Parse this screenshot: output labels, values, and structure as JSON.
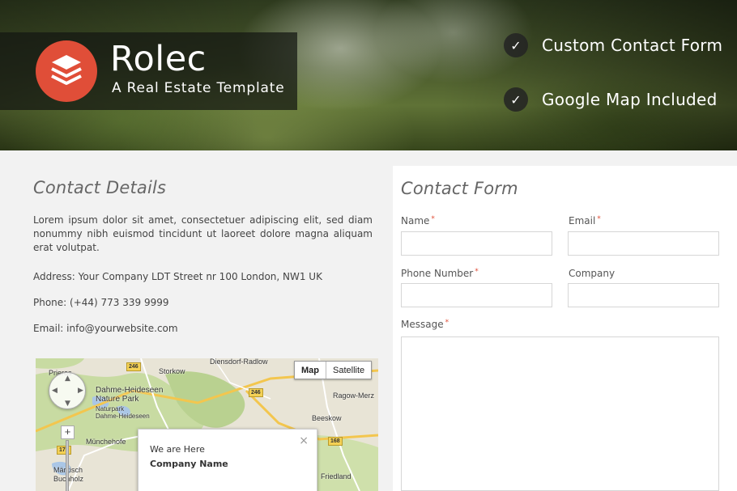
{
  "brand": {
    "name": "Rolec",
    "tagline": "A Real Estate Template",
    "logo_color": "#e04e38"
  },
  "features": [
    {
      "label": "Custom Contact Form",
      "icon": "check-icon"
    },
    {
      "label": "Google Map Included",
      "icon": "check-icon"
    }
  ],
  "details": {
    "title": "Contact Details",
    "intro": "Lorem ipsum dolor sit amet, consectetuer adipiscing elit, sed diam nonummy nibh euismod tincidunt ut laoreet dolore magna aliquam erat volutpat.",
    "address": "Address: Your Company LDT Street nr 100 London, NW1 UK",
    "phone": "Phone: (+44) 773 339 9999",
    "email": "Email: info@yourwebsite.com"
  },
  "map": {
    "type_map": "Map",
    "type_satellite": "Satellite",
    "zoom_in": "+",
    "labels": {
      "diensdorf": "Diensdorf-Radlow",
      "storkow": "Storkow",
      "prieros": "Prieros",
      "dahme": "Dahme-Heideseen",
      "nature_park": "Nature Park",
      "naturpark": "Naturpark",
      "dahme_de": "Dahme-Heideseen",
      "ragow": "Ragow-Merz",
      "beeskow": "Beeskow",
      "munchehofe": "Münchehofe",
      "markisch": "Märkisch",
      "buchholz": "Buchholz",
      "friedland": "Friedland"
    },
    "roads": {
      "r1": "246",
      "r2": "246",
      "r3": "179",
      "r4": "168"
    },
    "info": {
      "line1": "We are Here",
      "line2": "Company Name",
      "close": "×"
    }
  },
  "form": {
    "title": "Contact Form",
    "name_label": "Name",
    "email_label": "Email",
    "phone_label": "Phone Number",
    "company_label": "Company",
    "message_label": "Message",
    "required_mark": "*",
    "name_value": "",
    "email_value": "",
    "phone_value": "",
    "company_value": "",
    "message_value": ""
  }
}
